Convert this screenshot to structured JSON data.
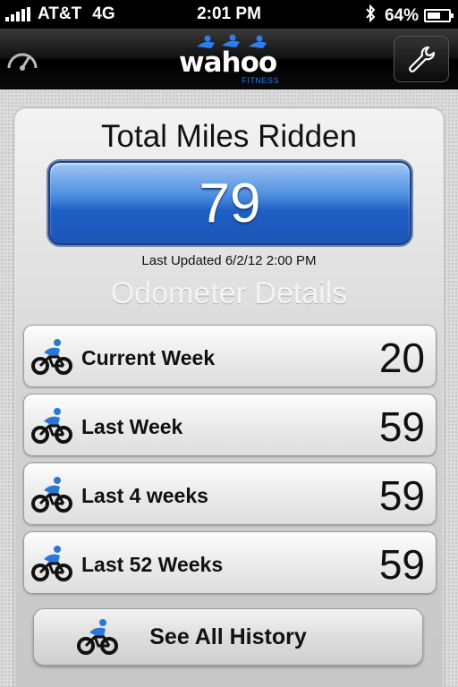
{
  "status_bar": {
    "carrier": "AT&T",
    "network": "4G",
    "time": "2:01 PM",
    "battery_percent": "64%",
    "battery_level": 0.64,
    "bluetooth_icon": "bluetooth-icon"
  },
  "nav": {
    "logo_word": "wahoo",
    "logo_sub": "FITNESS",
    "left_icon": "speedometer-icon",
    "right_icon": "wrench-icon"
  },
  "summary": {
    "title": "Total Miles Ridden",
    "total": "79",
    "last_updated": "Last Updated 6/2/12 2:00 PM"
  },
  "odometer": {
    "title": "Odometer Details",
    "rows": [
      {
        "label": "Current Week",
        "value": "20",
        "icon": "bicycle-icon"
      },
      {
        "label": "Last Week",
        "value": "59",
        "icon": "bicycle-icon"
      },
      {
        "label": "Last 4 weeks",
        "value": "59",
        "icon": "bicycle-icon"
      },
      {
        "label": "Last 52 Weeks",
        "value": "59",
        "icon": "bicycle-icon"
      }
    ]
  },
  "history_button": {
    "label": "See All History",
    "icon": "bicycle-icon"
  },
  "colors": {
    "accent_blue": "#1d5fc5",
    "logo_blue": "#2c7ff0",
    "icon_blue": "#2a78d6"
  }
}
